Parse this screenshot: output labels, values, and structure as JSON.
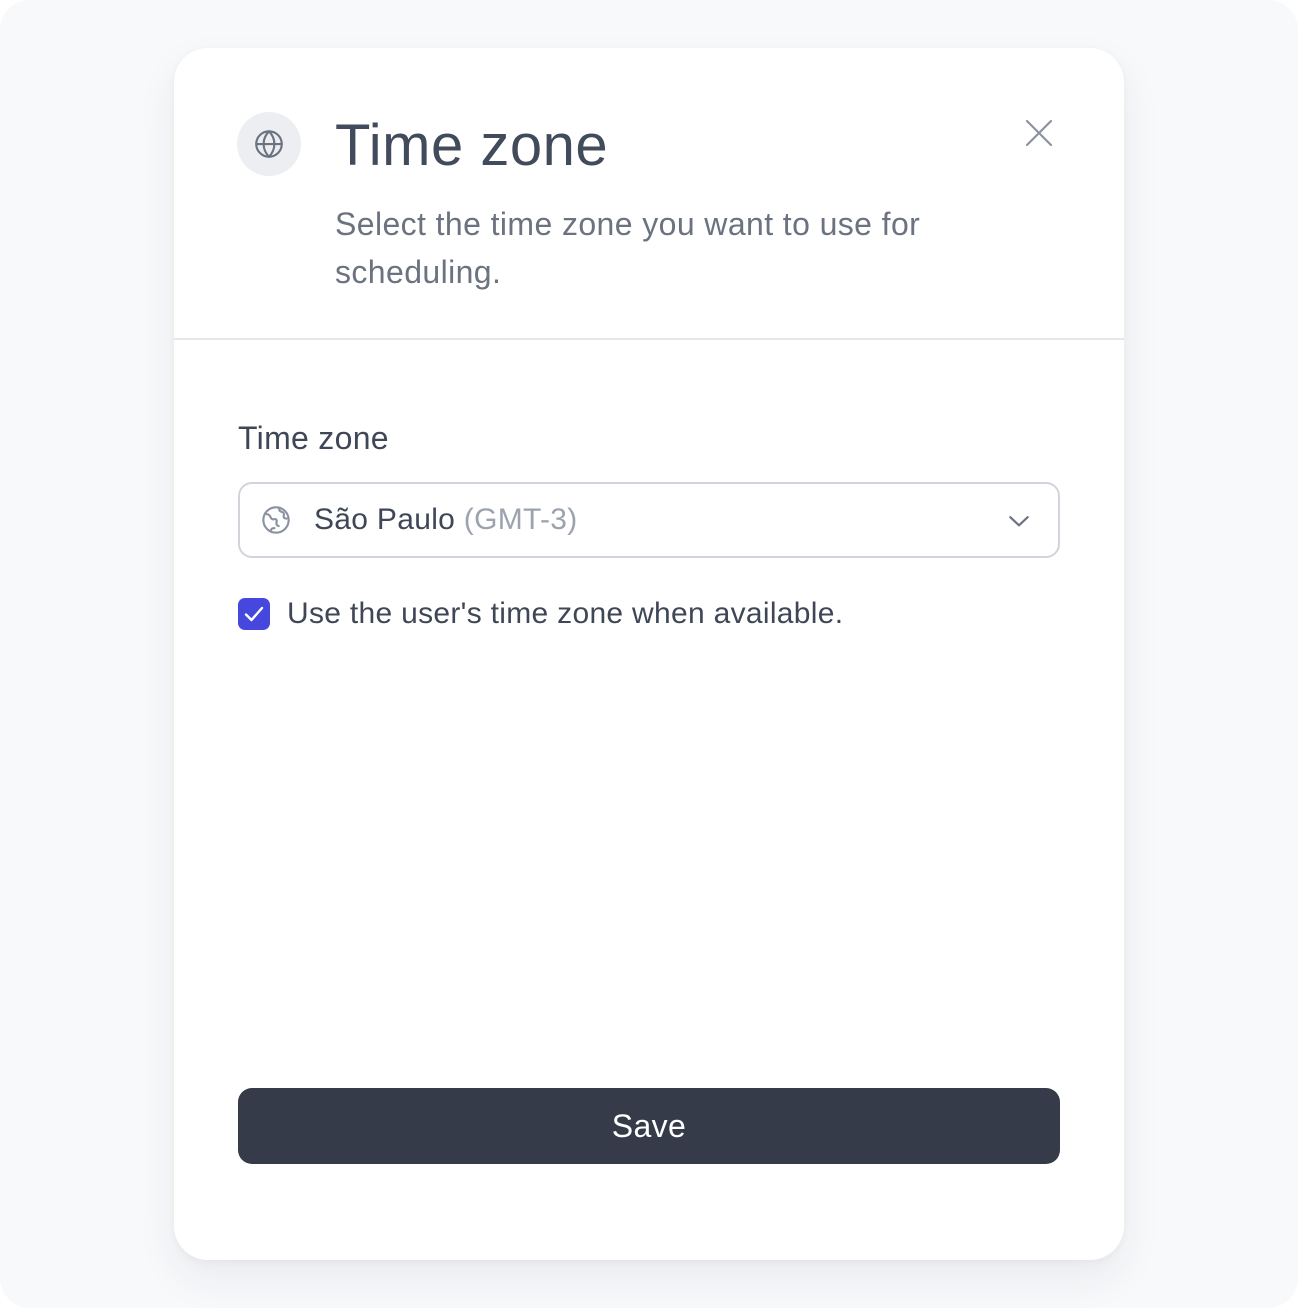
{
  "modal": {
    "header_icon": "globe-icon",
    "title": "Time zone",
    "subtitle": "Select the time zone you want to use for scheduling.",
    "close_icon": "close-icon"
  },
  "form": {
    "field_label": "Time zone",
    "select": {
      "icon": "globe-icon",
      "city": "São Paulo",
      "offset": "(GMT-3)",
      "chevron_icon": "chevron-down-icon"
    },
    "checkbox": {
      "checked": true,
      "label": "Use the user's time zone when available."
    },
    "save_label": "Save"
  },
  "colors": {
    "accent": "#4647dc",
    "primary_button": "#353b48",
    "title_text": "#414b5c",
    "muted_text": "#6b7280",
    "border": "#d1d5db",
    "backdrop": "#f8f9fb"
  }
}
